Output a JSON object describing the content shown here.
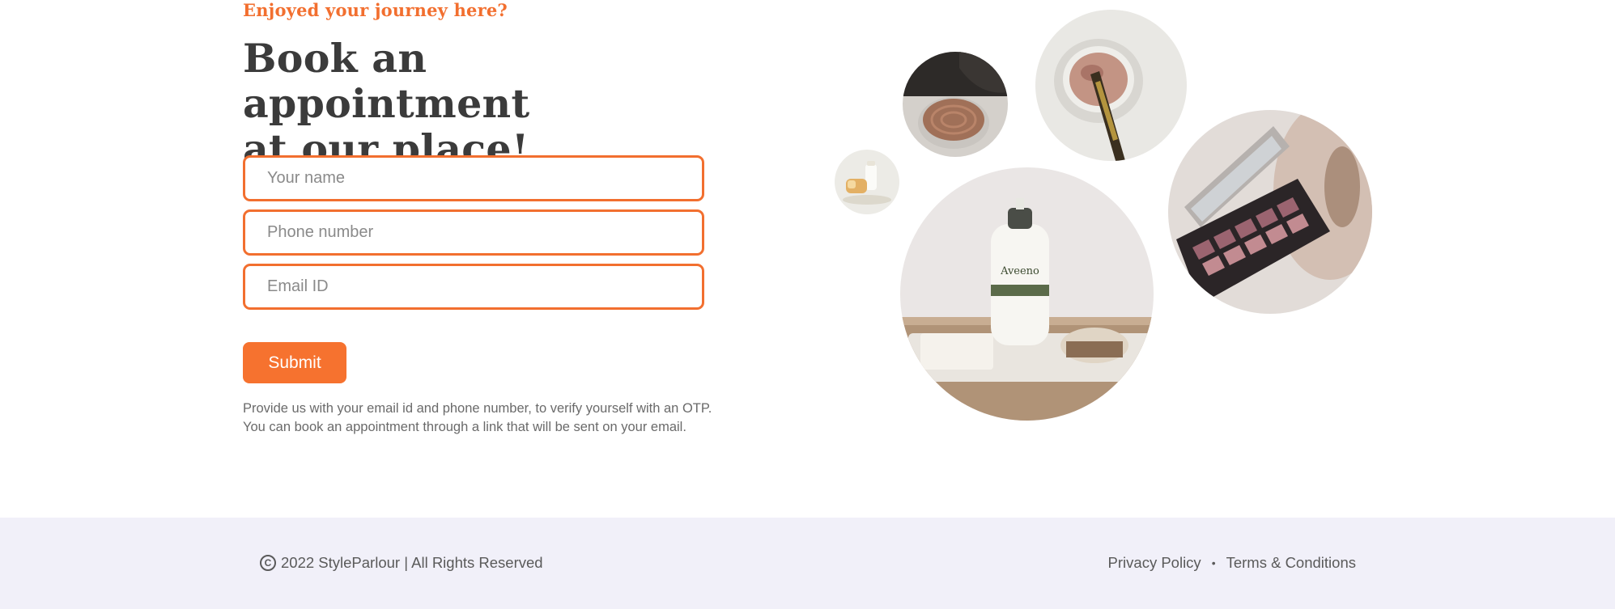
{
  "hero": {
    "eyebrow": "Enjoyed your journey here?",
    "headline_line1": "Book an appointment",
    "headline_line2": "at our place!"
  },
  "form": {
    "name_placeholder": "Your name",
    "phone_placeholder": "Phone number",
    "email_placeholder": "Email ID",
    "submit_label": "Submit",
    "note_line1": "Provide us with your email id and phone number, to verify yourself with an OTP.",
    "note_line2": "You can book an appointment through a link that will be sent on your email."
  },
  "footer": {
    "copyright_symbol": "C",
    "copyright_text": "2022 StyleParlour | All Rights Reserved",
    "privacy_label": "Privacy Policy",
    "separator": "•",
    "terms_label": "Terms & Conditions"
  },
  "colors": {
    "accent": "#f26f2f",
    "footer_bg": "#f1f0f9"
  },
  "images": {
    "lotion_brand": "Aveeno"
  }
}
